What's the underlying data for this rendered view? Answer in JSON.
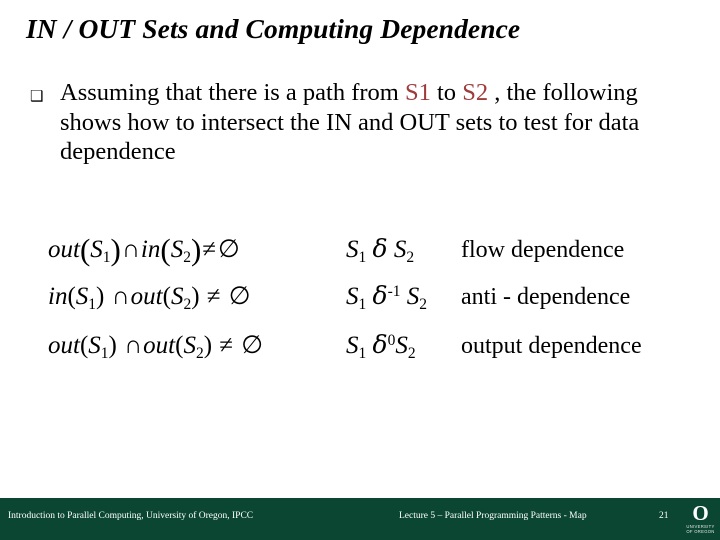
{
  "slide": {
    "title": "IN / OUT Sets and Computing Dependence",
    "bullet_marker": "hollow-square-bullet",
    "bullet_marker_glyph": "❑",
    "bullet": {
      "part1": "Assuming that there is a path from ",
      "stmt1": "S1",
      "part2": " to ",
      "stmt2": "S2",
      "part3": " , the following shows how to intersect the IN and OUT sets to test for data dependence"
    },
    "accent_color": "#9E3B3B",
    "footer_color": "#0A4632"
  },
  "equations": {
    "rows": [
      {
        "set_expr": {
          "lhs_fn": "out",
          "lhs_arg": "S",
          "lhs_sub": "1",
          "operator": "∩",
          "rhs_fn": "in",
          "rhs_arg": "S",
          "rhs_sub": "2",
          "relation": "≠",
          "empty_set": "∅",
          "plain": "out(S1)∩in(S2)≠∅"
        },
        "delta_expr": {
          "left": "S",
          "left_sub": "1",
          "symbol": "δ",
          "exponent": "",
          "right": "S",
          "right_sub": "2",
          "plain": "S1 δ S2"
        },
        "name": "flow dependence"
      },
      {
        "set_expr": {
          "lhs_fn": "in",
          "lhs_arg": "S",
          "lhs_sub": "1",
          "operator": "∩",
          "rhs_fn": "out",
          "rhs_arg": "S",
          "rhs_sub": "2",
          "relation": "≠",
          "empty_set": "∅",
          "plain": "in(S1)∩out(S2)≠∅"
        },
        "delta_expr": {
          "left": "S",
          "left_sub": "1",
          "symbol": "δ",
          "exponent": "-1",
          "right": "S",
          "right_sub": "2",
          "plain": "S1 δ⁻¹ S2"
        },
        "name": "anti - dependence"
      },
      {
        "set_expr": {
          "lhs_fn": "out",
          "lhs_arg": "S",
          "lhs_sub": "1",
          "operator": "∩",
          "rhs_fn": "out",
          "rhs_arg": "S",
          "rhs_sub": "2",
          "relation": "≠",
          "empty_set": "∅",
          "plain": "out(S1)∩out(S2)≠∅"
        },
        "delta_expr": {
          "left": "S",
          "left_sub": "1",
          "symbol": "δ",
          "exponent": "0",
          "right": "S",
          "right_sub": "2",
          "plain": "S1 δ⁰ S2"
        },
        "name": "output dependence"
      }
    ]
  },
  "footer": {
    "left": "Introduction to Parallel Computing, University of Oregon, IPCC",
    "center": "Lecture 5 – Parallel Programming Patterns - Map",
    "page_number": "21",
    "logo": {
      "glyph": "O",
      "line1": "UNIVERSITY",
      "line2": "OF OREGON"
    }
  }
}
